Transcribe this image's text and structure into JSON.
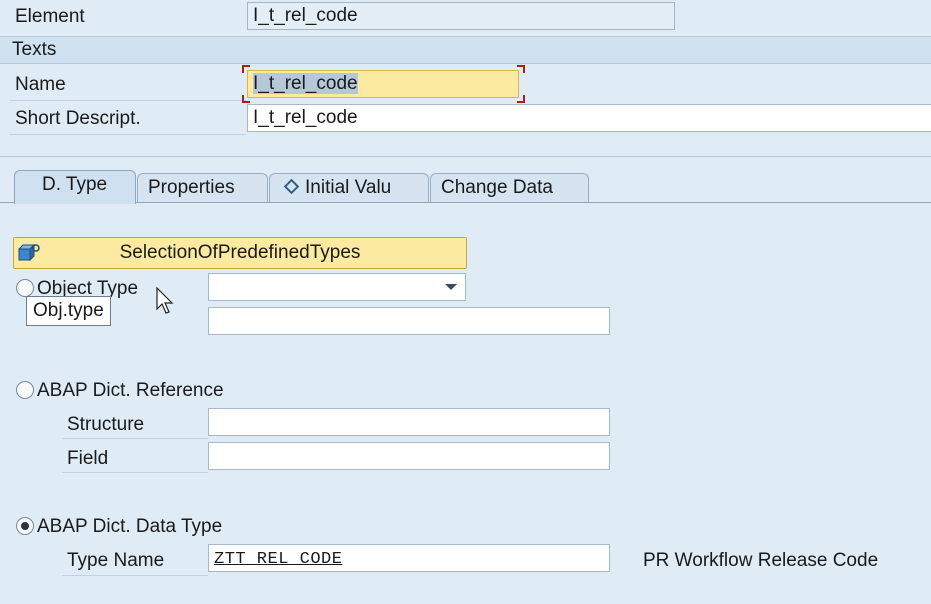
{
  "header": {
    "element_label": "Element",
    "element_value": "I_t_rel_code"
  },
  "texts_group": {
    "title": "Texts",
    "name_label": "Name",
    "name_value": "I_t_rel_code",
    "short_desc_label": "Short Descript.",
    "short_desc_value": "I_t_rel_code"
  },
  "tabs": [
    {
      "label": "D. Type",
      "active": true
    },
    {
      "label": "Properties",
      "active": false
    },
    {
      "label": "Initial Valu",
      "active": false,
      "icon": "diamond-icon"
    },
    {
      "label": "Change Data",
      "active": false
    }
  ],
  "dtype": {
    "selection_button": "SelectionOfPredefinedTypes",
    "object_type": {
      "label": "Object Type",
      "value": "",
      "selected": false,
      "tooltip": "Obj.type",
      "second_value": ""
    },
    "dict_reference": {
      "label": "ABAP Dict. Reference",
      "selected": false,
      "structure_label": "Structure",
      "structure_value": "",
      "field_label": "Field",
      "field_value": ""
    },
    "dict_data_type": {
      "label": "ABAP Dict. Data Type",
      "selected": true,
      "type_name_label": "Type Name",
      "type_name_value": "ZTT_REL_CODE",
      "description": "PR Workflow Release Code"
    }
  },
  "colors": {
    "background": "#dfebf5",
    "selection_button": "#fbeaa0",
    "focused_field": "#fbeaa0",
    "focus_marker": "#b31b1b"
  }
}
